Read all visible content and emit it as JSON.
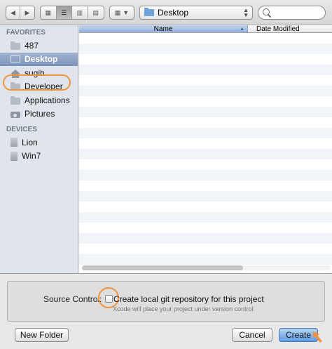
{
  "toolbar": {
    "location": "Desktop"
  },
  "sidebar": {
    "favorites_header": "FAVORITES",
    "favorites": [
      {
        "label": "487",
        "icon": "folder-icon"
      },
      {
        "label": "Desktop",
        "icon": "desktop-icon",
        "selected": true
      },
      {
        "label": "sugih",
        "icon": "home-icon"
      },
      {
        "label": "Developer",
        "icon": "folder-icon"
      },
      {
        "label": "Applications",
        "icon": "applications-icon"
      },
      {
        "label": "Pictures",
        "icon": "camera-icon"
      }
    ],
    "devices_header": "DEVICES",
    "devices": [
      {
        "label": "Lion",
        "icon": "disk-icon"
      },
      {
        "label": "Win7",
        "icon": "disk-icon"
      }
    ]
  },
  "file_list": {
    "columns": [
      "Name",
      "Date Modified"
    ]
  },
  "options": {
    "source_control_label": "Source Control:",
    "git_checkbox_label": "Create local git repository for this project",
    "git_checked": false,
    "git_hint": "Xcode will place your project under version control"
  },
  "buttons": {
    "new_folder": "New Folder",
    "cancel": "Cancel",
    "create": "Create"
  },
  "colors": {
    "annotation": "#f2933c",
    "selection": "#7b92ba",
    "default_button": "#5e9ae3"
  }
}
